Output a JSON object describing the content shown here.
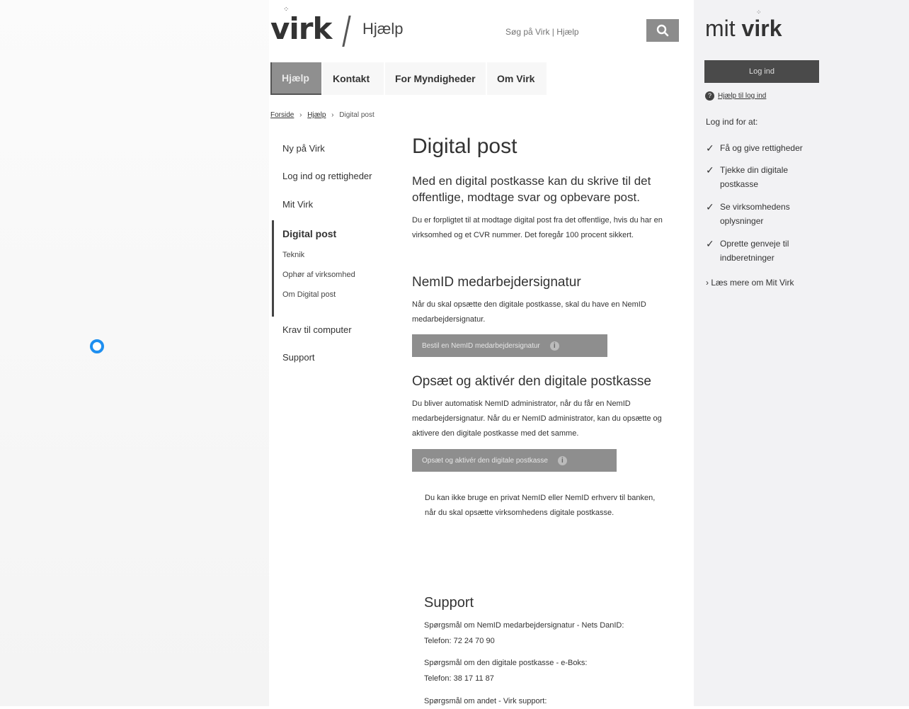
{
  "header": {
    "logo": "virk",
    "logo_dots": "⁘",
    "section": "Hjælp",
    "search_placeholder": "Søg på Virk | Hjælp"
  },
  "nav": {
    "tabs": [
      {
        "label": "Hjælp"
      },
      {
        "label": "Kontakt"
      },
      {
        "label": "For Myndigheder"
      },
      {
        "label": "Om Virk"
      }
    ]
  },
  "breadcrumb": {
    "items": [
      "Forside",
      "Hjælp"
    ],
    "current": "Digital post",
    "separator": "›"
  },
  "sidebar": {
    "items": [
      "Ny på Virk",
      "Log ind og rettigheder",
      "Mit Virk",
      "Digital post",
      "Krav til computer",
      "Support"
    ],
    "subitems": [
      "Teknik",
      "Ophør af virksomhed",
      "Om Digital post"
    ]
  },
  "main": {
    "title": "Digital post",
    "lead": "Med en digital postkasse kan du skrive til det offentlige, modtage svar og opbevare post.",
    "intro": "Du er forpligtet til at modtage digital post fra det offentlige, hvis du har en virksomhed og et CVR nummer. Det foregår 100 procent sikkert.",
    "section1_title": "NemID medarbejdersignatur",
    "section1_text": "Når du skal opsætte den digitale postkasse, skal du have en NemID medarbejdersignatur.",
    "section1_button": "Bestil en NemID medarbejdersignatur",
    "section2_title": "Opsæt og aktivér den digitale postkasse",
    "section2_text": "Du bliver automatisk NemID administrator, når du får en NemID medarbejdersignatur. Når du er NemID administrator, kan du opsætte og aktivere den digitale postkasse med det samme.",
    "section2_button": "Opsæt og aktivér den digitale postkasse",
    "note": "Du kan ikke bruge en privat NemID eller NemID erhverv til banken, når du skal opsætte virksomhedens digitale postkasse.",
    "info_icon": "i"
  },
  "support": {
    "title": "Support",
    "lines": [
      "Spørgsmål om NemID medarbejdersignatur - Nets DanID:",
      "Telefon: 72 24 70 90",
      "Spørgsmål om den digitale postkasse - e-Boks:",
      "Telefon: 38 17 11 87",
      "Spørgsmål om andet - Virk support:"
    ]
  },
  "right_panel": {
    "logo_plain": "mit ",
    "logo_bold": "virk",
    "logo_dots": "⁘",
    "login_button": "Log ind",
    "help_login": "Hjælp til log ind",
    "help_icon": "?",
    "intro": "Log ind for at:",
    "checklist": [
      "Få og give rettigheder",
      "Tjekke din digitale postkasse",
      "Se virksomhedens oplysninger",
      "Oprette genveje til indberetninger"
    ],
    "check_mark": "✓",
    "read_more": "› Læs mere om Mit Virk"
  },
  "colors": {
    "accent": "#8e8e8e",
    "dark_button": "#4a4a4a",
    "panel_bg": "#f2f2f4",
    "cursor": "#1e8ff0"
  }
}
